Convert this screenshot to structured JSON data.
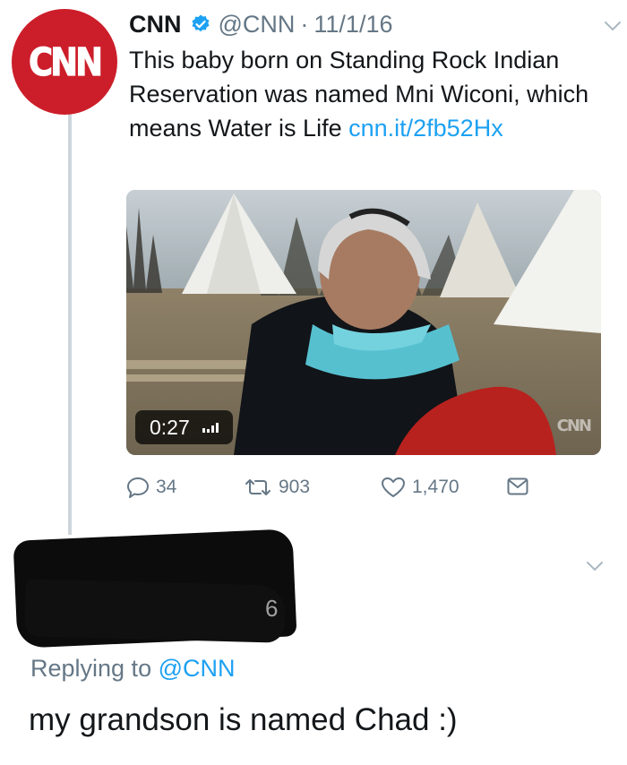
{
  "tweet": {
    "avatar": {
      "logo_text": "CNN",
      "color": "#cc1e2a"
    },
    "author_name": "CNN",
    "handle": "@CNN",
    "separator": "·",
    "date": "11/1/16",
    "verified_icon": "verified-badge-icon",
    "text": "This baby born on Standing Rock Indian Reservation was named Mni Wiconi, which means Water is Life ",
    "link_text": "cnn.it/2fb52Hx",
    "media": {
      "duration": "0:27",
      "watermark": "CNN",
      "description_icon": "video-thumbnail"
    },
    "actions": {
      "reply_count": "34",
      "retweet_count": "903",
      "like_count": "1,470"
    }
  },
  "reply": {
    "redacted_fragment": "6",
    "replying_prefix": "Replying to ",
    "replying_mention": "@CNN",
    "text": "my grandson is named Chad :)"
  },
  "colors": {
    "link": "#1da1f2",
    "secondary_text": "#657786",
    "cnn_red": "#cc1e2a"
  }
}
